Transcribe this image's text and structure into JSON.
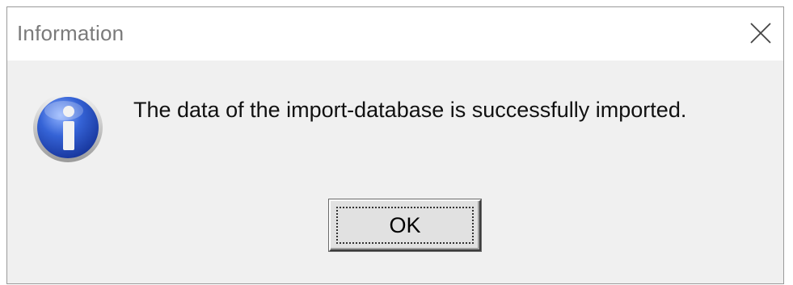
{
  "dialog": {
    "title": "Information",
    "message": "The data of the import-database is successfully imported.",
    "ok_label": "OK"
  },
  "icons": {
    "info": "information-icon",
    "close": "close-icon"
  },
  "colors": {
    "dialog_background": "#f0f0f0",
    "title_bar_background": "#ffffff",
    "title_text": "#7a7a7a",
    "icon_blue": "#2d5bd2"
  }
}
